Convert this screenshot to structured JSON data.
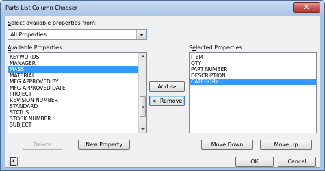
{
  "window": {
    "title": "Parts List Column Chooser",
    "close_symbol": "✕"
  },
  "source": {
    "label_prefix": "",
    "label_mnemonic": "S",
    "label_rest": "elect available properties from:",
    "selected": "All Properties"
  },
  "available": {
    "label_mnemonic": "A",
    "label_rest": "vailable Properties:",
    "items": [
      "KEYWORDS",
      "MANAGER",
      "MASS",
      "MATERIAL",
      "MFG APPROVED BY",
      "MFG APPROVED DATE",
      "PROJECT",
      "REVISION NUMBER",
      "STANDARD",
      "STATUS",
      "STOCK NUMBER",
      "SUBJECT"
    ],
    "selected": "MASS"
  },
  "selected_props": {
    "label_prefix": "S",
    "label_mnemonic": "e",
    "label_rest": "lected Properties:",
    "items": [
      "ITEM",
      "QTY",
      "PART NUMBER",
      "DESCRIPTION",
      "CATEGORY"
    ],
    "selected": "CATEGORY"
  },
  "buttons": {
    "add": "Add ->",
    "remove": "<- Remove",
    "delete": "Delete",
    "new_property": "New Property",
    "move_down": "Move Down",
    "move_up": "Move Up",
    "ok": "OK",
    "cancel": "Cancel"
  },
  "icons": {
    "close": "close-icon",
    "help": "help-icon",
    "dropdown": "chevron-down-icon"
  }
}
